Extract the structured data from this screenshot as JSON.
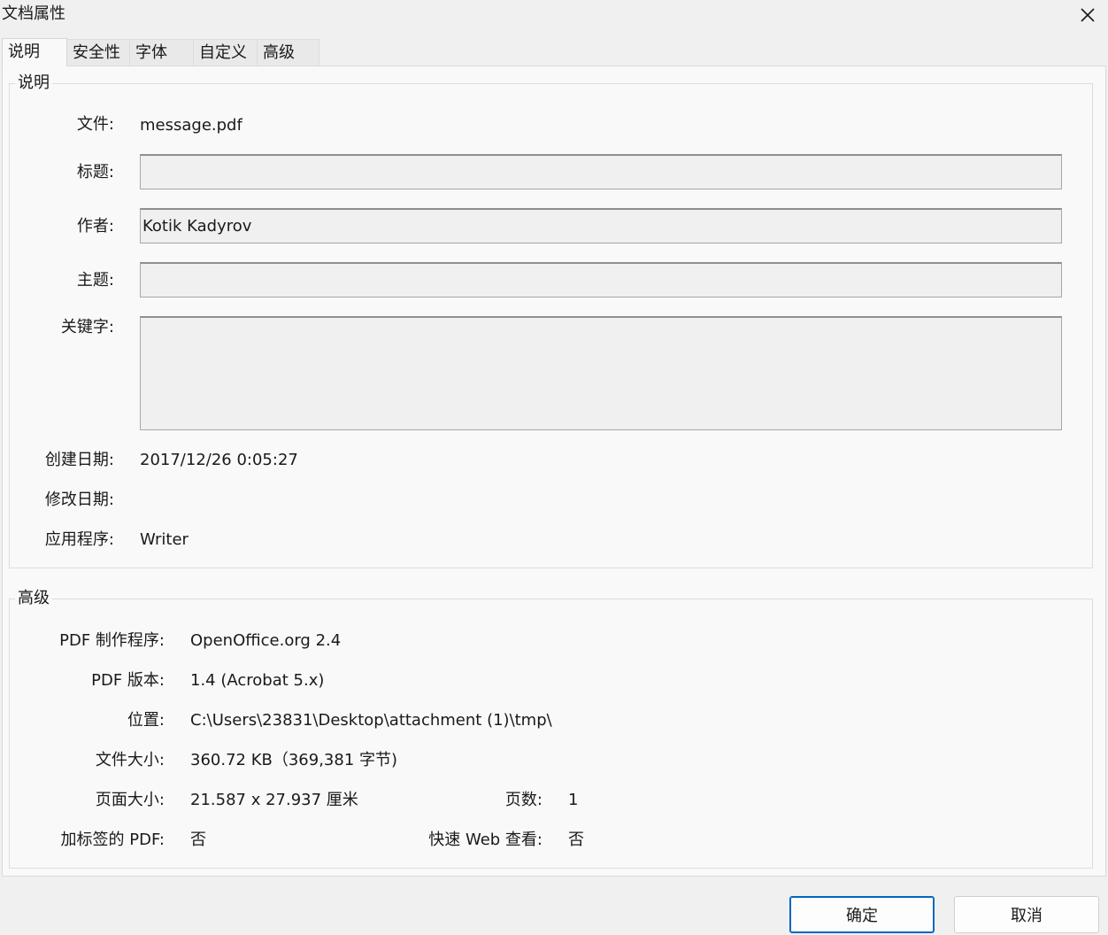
{
  "window": {
    "title": "文档属性"
  },
  "tabs": [
    {
      "label": "说明",
      "active": true
    },
    {
      "label": "安全性",
      "active": false
    },
    {
      "label": "字体",
      "active": false
    },
    {
      "label": "自定义",
      "active": false
    },
    {
      "label": "高级",
      "active": false
    }
  ],
  "description": {
    "legend": "说明",
    "file_label": "文件:",
    "file_value": "message.pdf",
    "title_label": "标题:",
    "title_value": "",
    "author_label": "作者:",
    "author_value": "Kotik Kadyrov",
    "subject_label": "主题:",
    "subject_value": "",
    "keywords_label": "关键字:",
    "keywords_value": "",
    "created_label": "创建日期:",
    "created_value": "2017/12/26 0:05:27",
    "modified_label": "修改日期:",
    "modified_value": "",
    "application_label": "应用程序:",
    "application_value": "Writer"
  },
  "advanced": {
    "legend": "高级",
    "producer_label": "PDF 制作程序:",
    "producer_value": "OpenOffice.org 2.4",
    "version_label": "PDF 版本:",
    "version_value": "1.4 (Acrobat 5.x)",
    "location_label": "位置:",
    "location_value": "C:\\Users\\23831\\Desktop\\attachment (1)\\tmp\\",
    "filesize_label": "文件大小:",
    "filesize_value": "360.72 KB（369,381 字节)",
    "pagesize_label": "页面大小:",
    "pagesize_value": "21.587 x 27.937 厘米",
    "pagecount_label": "页数:",
    "pagecount_value": "1",
    "tagged_label": "加标签的 PDF:",
    "tagged_value": "否",
    "fastweb_label": "快速 Web 查看:",
    "fastweb_value": "否"
  },
  "buttons": {
    "ok": "确定",
    "cancel": "取消"
  },
  "colors": {
    "primary_button_border": "#0067c0",
    "dialog_background": "#f0f0f0",
    "panel_background": "#f9f9f9"
  }
}
